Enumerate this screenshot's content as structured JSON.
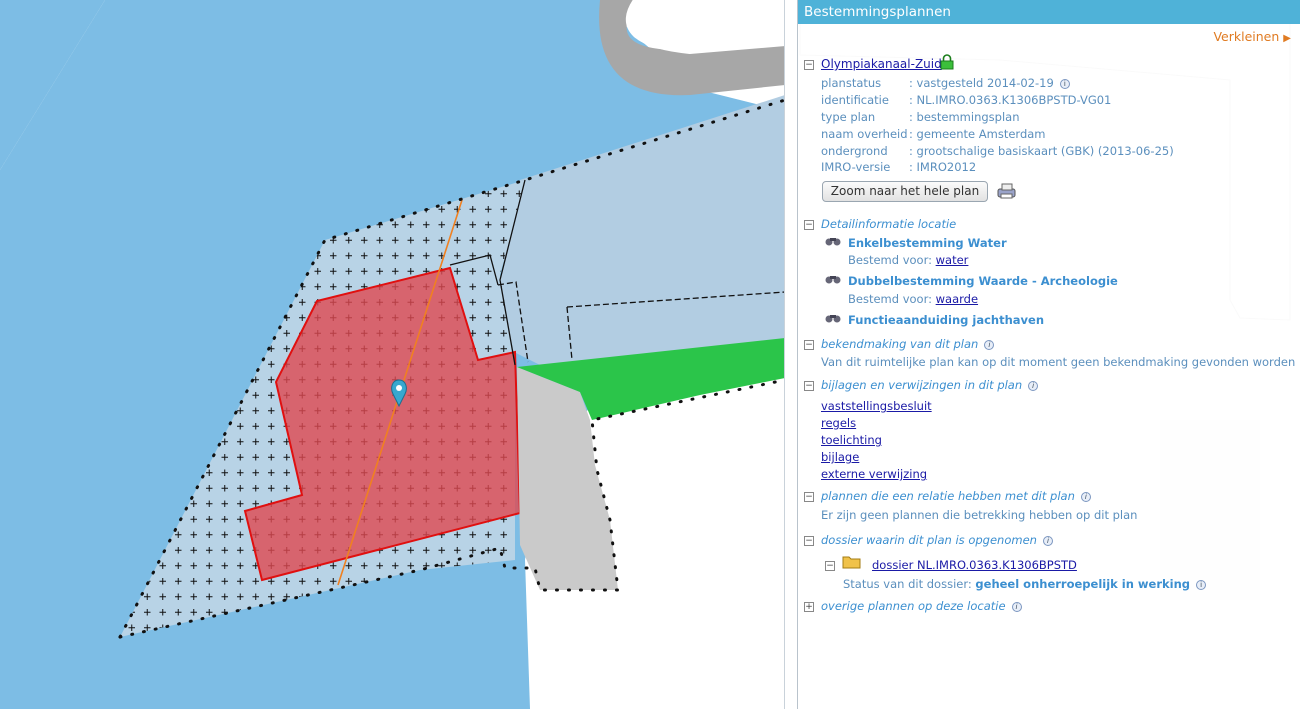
{
  "panel": {
    "title": "Bestemmingsplannen",
    "shrink_label": "Verkleinen",
    "plan": {
      "name": "Olympiakanaal-Zuid",
      "fields": [
        {
          "label": "planstatus",
          "value": ": vastgesteld 2014-02-19"
        },
        {
          "label": "identificatie",
          "value": ": NL.IMRO.0363.K1306BPSTD-VG01"
        },
        {
          "label": "type plan",
          "value": ": bestemmingsplan"
        },
        {
          "label": "naam overheid",
          "value": ": gemeente Amsterdam"
        },
        {
          "label": "ondergrond",
          "value": ": grootschalige basiskaart (GBK) (2013-06-25)"
        },
        {
          "label": "IMRO-versie",
          "value": ": IMRO2012"
        }
      ],
      "zoom_button": "Zoom naar het hele plan"
    },
    "detail": {
      "header": "Detailinformatie locatie",
      "items": [
        {
          "title": "Enkelbestemming Water",
          "prefix": "Bestemd voor:",
          "link": "water"
        },
        {
          "title": "Dubbelbestemming Waarde - Archeologie",
          "prefix": "Bestemd voor:",
          "link": "waarde"
        },
        {
          "title": "Functieaanduiding jachthaven"
        }
      ]
    },
    "bekendmaking": {
      "header": "bekendmaking van dit plan",
      "text": "Van dit ruimtelijke plan kan op dit moment geen bekendmaking gevonden worden"
    },
    "bijlagen": {
      "header": "bijlagen en verwijzingen in dit plan",
      "links": [
        "vaststellingsbesluit",
        "regels",
        "toelichting",
        "bijlage",
        "externe verwijzing"
      ]
    },
    "relaties": {
      "header": "plannen die een relatie hebben met dit plan",
      "text": "Er zijn geen plannen die betrekking hebben op dit plan"
    },
    "dossier": {
      "header": "dossier waarin dit plan is opgenomen",
      "link": "dossier NL.IMRO.0363.K1306BPSTD",
      "status_label": "Status van dit dossier:",
      "status_value": "geheel onherroepelijk in werking"
    },
    "overige": {
      "header": "overige plannen op deze locatie"
    }
  },
  "colors": {
    "water": "#7dbde5",
    "plan_area": "#b8d3e6",
    "archeologie": "#dc5f68",
    "jachthaven_green": "#2bc54a",
    "titlebar": "#4fb2d8",
    "link": "#1a1aa6"
  },
  "icons": [
    "lock-icon",
    "zoom-print-icon",
    "binoculars-icon",
    "folder-icon",
    "info-icon",
    "map-pin-icon",
    "expand-icon",
    "collapse-icon"
  ]
}
